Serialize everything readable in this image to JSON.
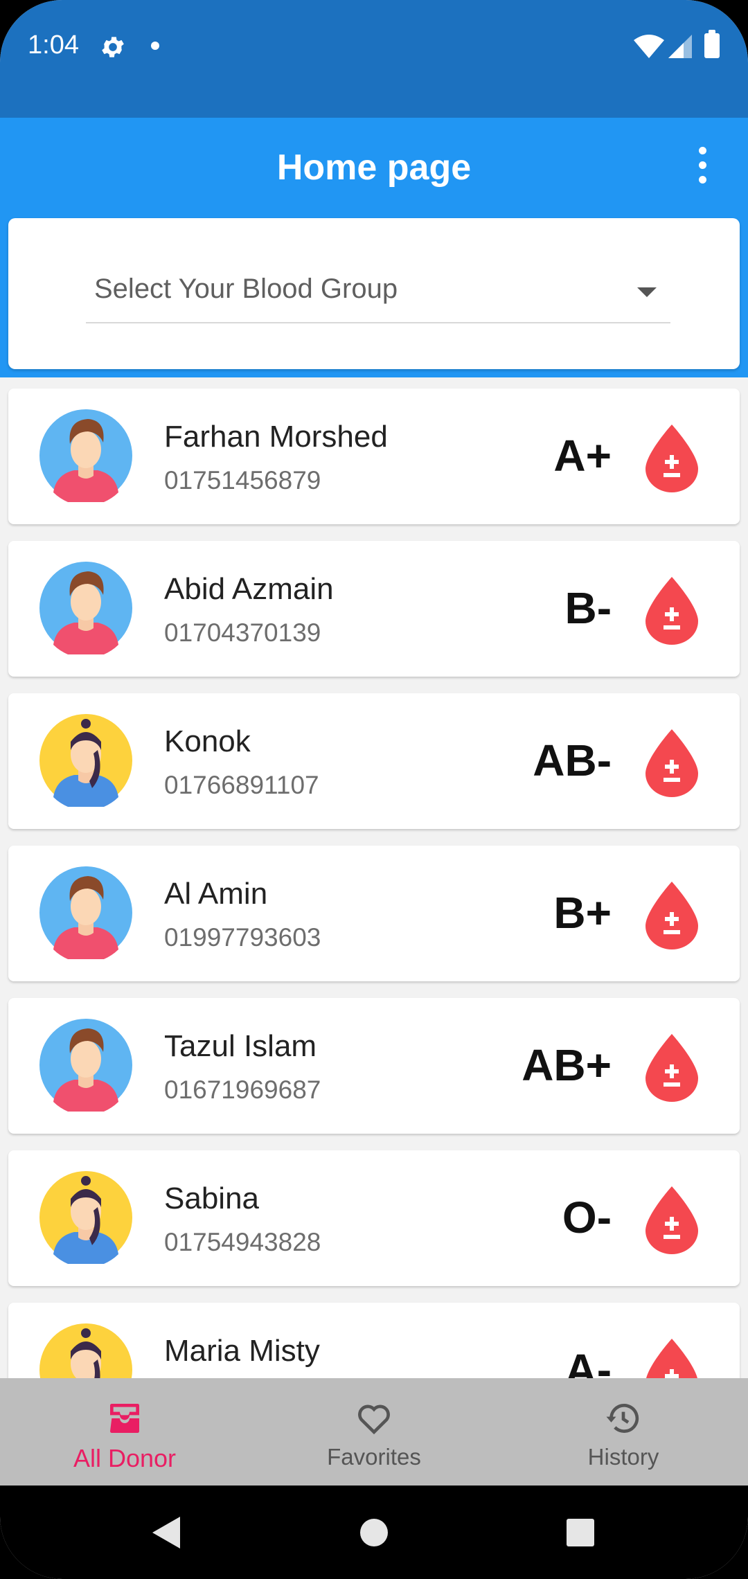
{
  "status_bar": {
    "time": "1:04",
    "icons": [
      "gear-icon",
      "dot-icon",
      "wifi-icon",
      "signal-icon",
      "battery-icon"
    ]
  },
  "app_bar": {
    "title": "Home page",
    "menu_icon": "more-vert-icon"
  },
  "blood_select": {
    "placeholder": "Select Your Blood Group",
    "icon": "dropdown-arrow-icon"
  },
  "donors": [
    {
      "name": "Farhan Morshed",
      "phone": "01751456879",
      "blood_group": "A+",
      "avatar": "male-avatar"
    },
    {
      "name": "Abid Azmain",
      "phone": "01704370139",
      "blood_group": "B-",
      "avatar": "male-avatar"
    },
    {
      "name": "Konok",
      "phone": "01766891107",
      "blood_group": "AB-",
      "avatar": "female-avatar"
    },
    {
      "name": "Al Amin",
      "phone": "01997793603",
      "blood_group": "B+",
      "avatar": "male-avatar"
    },
    {
      "name": "Tazul Islam",
      "phone": "01671969687",
      "blood_group": "AB+",
      "avatar": "male-avatar"
    },
    {
      "name": "Sabina",
      "phone": "01754943828",
      "blood_group": "O-",
      "avatar": "female-avatar"
    },
    {
      "name": "Maria Misty",
      "phone": "",
      "blood_group": "A-",
      "avatar": "female-avatar"
    }
  ],
  "bottom_nav": {
    "items": [
      {
        "label": "All Donor",
        "icon": "inbox-icon",
        "active": true
      },
      {
        "label": "Favorites",
        "icon": "heart-icon",
        "active": false
      },
      {
        "label": "History",
        "icon": "history-icon",
        "active": false
      }
    ]
  },
  "colors": {
    "status_bar": "#1c71bf",
    "app_bar": "#2196f3",
    "accent": "#e91e63",
    "blood_drop": "#f4484f",
    "nav_bg": "#bdbdbd"
  }
}
